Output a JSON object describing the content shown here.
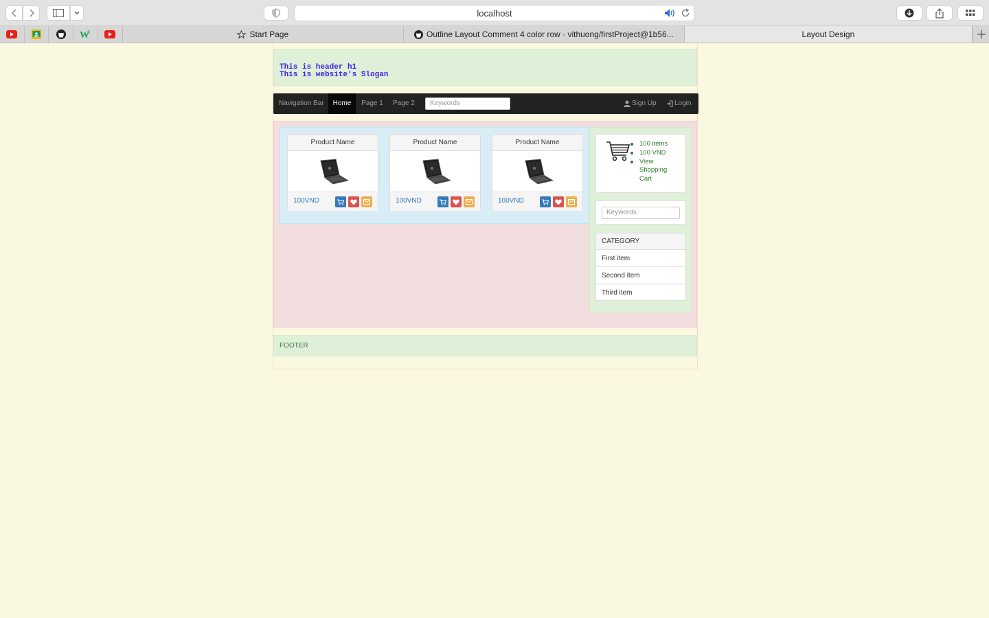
{
  "browser": {
    "url": "localhost",
    "tabs": [
      {
        "label": "Start Page",
        "icon": "star-icon"
      },
      {
        "label": "Outline Layout Comment 4 color row · vithuong/firstProject@1b56...",
        "icon": "github-icon"
      },
      {
        "label": "Layout Design",
        "icon": ""
      }
    ],
    "favorites": [
      "youtube-icon",
      "google-classroom-icon",
      "github-icon",
      "w3schools-icon",
      "youtube-icon"
    ]
  },
  "header": {
    "h1": "This is header h1",
    "slogan": "This is website's Slogan"
  },
  "navbar": {
    "brand": "Navigation Bar",
    "items": [
      "Home",
      "Page 1",
      "Page 2"
    ],
    "active": "Home",
    "search_placeholder": "Keywords",
    "signup": "Sign Up",
    "login": "Login"
  },
  "products": [
    {
      "name": "Product Name",
      "price": "100VND"
    },
    {
      "name": "Product Name",
      "price": "100VND"
    },
    {
      "name": "Product Name",
      "price": "100VND"
    }
  ],
  "cart": {
    "items": "100 items",
    "total": "100 VND",
    "link": [
      "View",
      "Shopping",
      "Cart"
    ]
  },
  "sidebar_search": {
    "placeholder": "Keywords"
  },
  "category": {
    "title": "CATEGORY",
    "items": [
      "First item",
      "Second item",
      "Third item"
    ]
  },
  "footer": {
    "text": "FOOTER"
  },
  "colors": {
    "background": "#faf8e1",
    "header_green": "#dff0d8",
    "main_pink": "#f2dede",
    "products_blue": "#d9edf7",
    "navbar": "#222222",
    "cart_btn": "#337ab7",
    "heart_btn": "#d9534f",
    "mail_btn": "#f0ad4e"
  }
}
